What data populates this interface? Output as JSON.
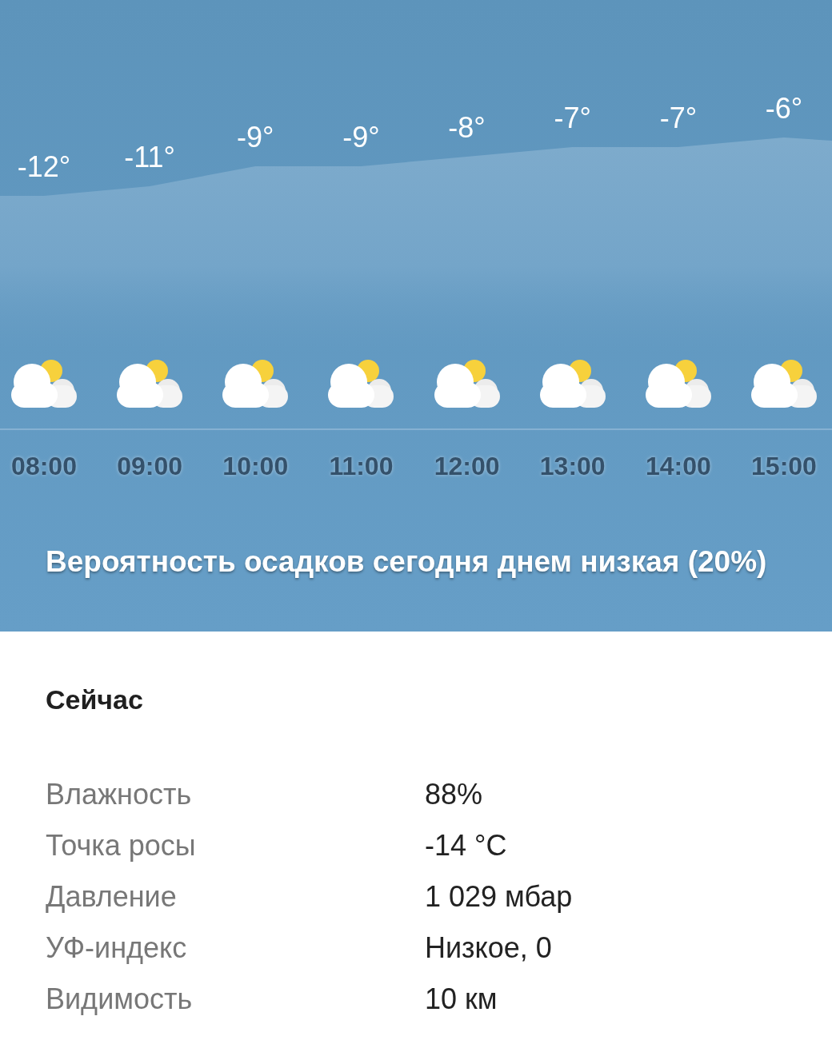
{
  "hourly_forecast": [
    {
      "temperature": "-12°",
      "time": "08:00"
    },
    {
      "temperature": "-11°",
      "time": "09:00"
    },
    {
      "temperature": "-9°",
      "time": "10:00"
    },
    {
      "temperature": "-9°",
      "time": "11:00"
    },
    {
      "temperature": "-8°",
      "time": "12:00"
    },
    {
      "temperature": "-7°",
      "time": "13:00"
    },
    {
      "temperature": "-7°",
      "time": "14:00"
    },
    {
      "temperature": "-6°",
      "time": "15:00"
    }
  ],
  "precipitation_summary": "Вероятность осадков сегодня днем низкая (20%)",
  "current_conditions": {
    "title": "Сейчас",
    "rows": [
      {
        "label": "Влажность",
        "value": "88%"
      },
      {
        "label": "Точка росы",
        "value": "-14 °C"
      },
      {
        "label": "Давление",
        "value": "1 029 мбар"
      },
      {
        "label": "УФ-индекс",
        "value": "Низкое, 0"
      },
      {
        "label": "Видимость",
        "value": "10 км"
      }
    ]
  }
}
